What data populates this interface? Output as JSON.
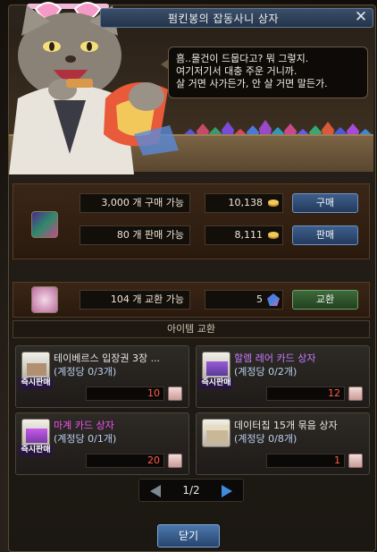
{
  "window": {
    "title": "펌킨봉의 잡동사니 상자",
    "close_glyph": "✕"
  },
  "npc": {
    "dialog_lines": [
      "흠..물건이 드뭅다고? 뭐 그렇지.",
      "여기저기서 대충 주운 거니까.",
      "살 거면 사가든가, 안 살 거면 말든가."
    ]
  },
  "trade_rows": {
    "buy": {
      "item_icon": "crystal-cube-icon",
      "quantity_text": "3,000 개 구매 가능",
      "price": "10,138",
      "currency_icon": "gold-coin-icon",
      "button_label": "구매"
    },
    "sell": {
      "quantity_text": "80 개 판매 가능",
      "price": "8,111",
      "currency_icon": "gold-coin-icon",
      "button_label": "판매"
    },
    "exchange": {
      "item_icon": "pink-orb-card-icon",
      "quantity_text": "104 개 교환 가능",
      "cost": "5",
      "currency_icon": "crystal-gem-icon",
      "button_label": "교환"
    }
  },
  "section_title": "아이템 교환",
  "exchange_items": [
    {
      "name": "테이베르스 입장권 3장 ...",
      "limit": "(계정당 0/3개)",
      "cost": "10",
      "tag": "즉시판매",
      "icon": "treasure-box-icon",
      "name_color": "#e6e6e6"
    },
    {
      "name": "할렘 레어 카드 상자",
      "limit": "(계정당 0/2개)",
      "cost": "12",
      "tag": "즉시판매",
      "icon": "card-box-icon",
      "name_color": "#c77dff"
    },
    {
      "name": "마계 카드 상자",
      "limit": "(계정당 0/1개)",
      "cost": "20",
      "tag": "즉시판매",
      "icon": "card-box-icon",
      "name_color": "#ee55ee"
    },
    {
      "name": "데이터칩 15개 묶음 상자",
      "limit": "(계정당 0/8개)",
      "cost": "1",
      "tag": "",
      "icon": "open-box-icon",
      "name_color": "#e6e6e6"
    }
  ],
  "pager": {
    "text": "1/2"
  },
  "footer": {
    "close_label": "닫기"
  },
  "colors": {
    "title_bar": "#2d4260",
    "buy_button": "#2f4d76",
    "exchange_button": "#2f5a2c",
    "price_red": "#ff5a4a",
    "limit_blue": "#b8d0f0",
    "pager_next": "#3f8be0"
  }
}
